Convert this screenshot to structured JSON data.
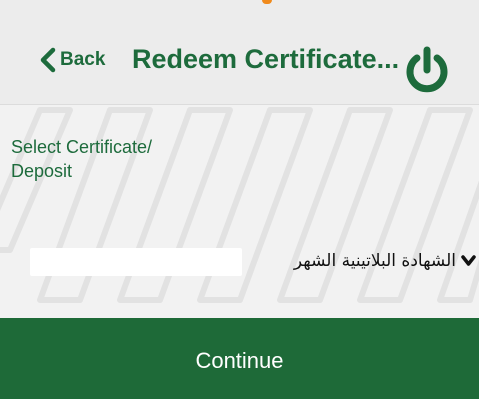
{
  "header": {
    "back_label": "Back",
    "title": "Redeem Certificate..."
  },
  "form": {
    "field_label": "Select Certificate/ Deposit",
    "selected_value": "الشهادة البلاتينية الشهر"
  },
  "actions": {
    "continue_label": "Continue"
  },
  "colors": {
    "brand_green": "#1d6b3c",
    "button_green": "#1e6a38",
    "header_bg": "#ececec",
    "status_accent": "#f08a1c"
  },
  "icons": {
    "back": "chevron-left-icon",
    "power": "power-icon",
    "dropdown": "chevron-down-icon"
  }
}
